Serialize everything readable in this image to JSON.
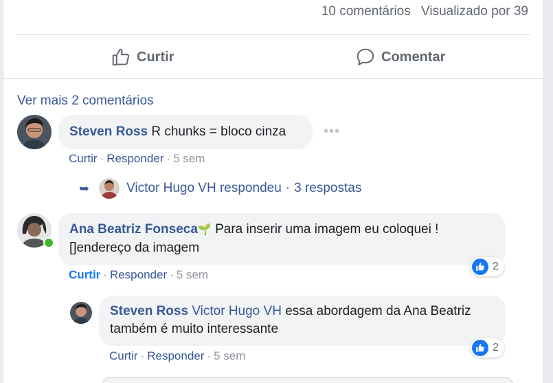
{
  "stats": {
    "comments": "10 comentários",
    "seen_by": "Visualizado por 39"
  },
  "actions": {
    "like": "Curtir",
    "comment": "Comentar"
  },
  "more_comments": "Ver mais 2 comentários",
  "comments": [
    {
      "author": "Steven Ross",
      "text": "R chunks = bloco cinza",
      "like": "Curtir",
      "reply": "Responder",
      "time": "5 sem",
      "replies_summary": {
        "author": "Victor Hugo VH",
        "action": "respondeu",
        "count": "3 respostas"
      }
    },
    {
      "author": "Ana Beatriz Fonseca",
      "badge": "🌱",
      "text": "Para inserir uma imagem eu coloquei ![]endereço da imagem",
      "like": "Curtir",
      "reply": "Responder",
      "time": "5 sem",
      "reaction_count": "2",
      "online": true
    }
  ],
  "reply": {
    "author": "Steven Ross",
    "mention": "Victor Hugo VH",
    "text": "essa abordagem da Ana Beatriz também é muito interessante",
    "like": "Curtir",
    "reply": "Responder",
    "time": "5 sem",
    "reaction_count": "2"
  },
  "icons": {
    "like": "thumbs-up-icon",
    "comment": "speech-bubble-icon",
    "reply_arrow": "reply-arrow-icon",
    "more": "more-options-icon"
  },
  "colors": {
    "link": "#385898",
    "like_blue": "#1877f2",
    "online": "#42b72a"
  }
}
